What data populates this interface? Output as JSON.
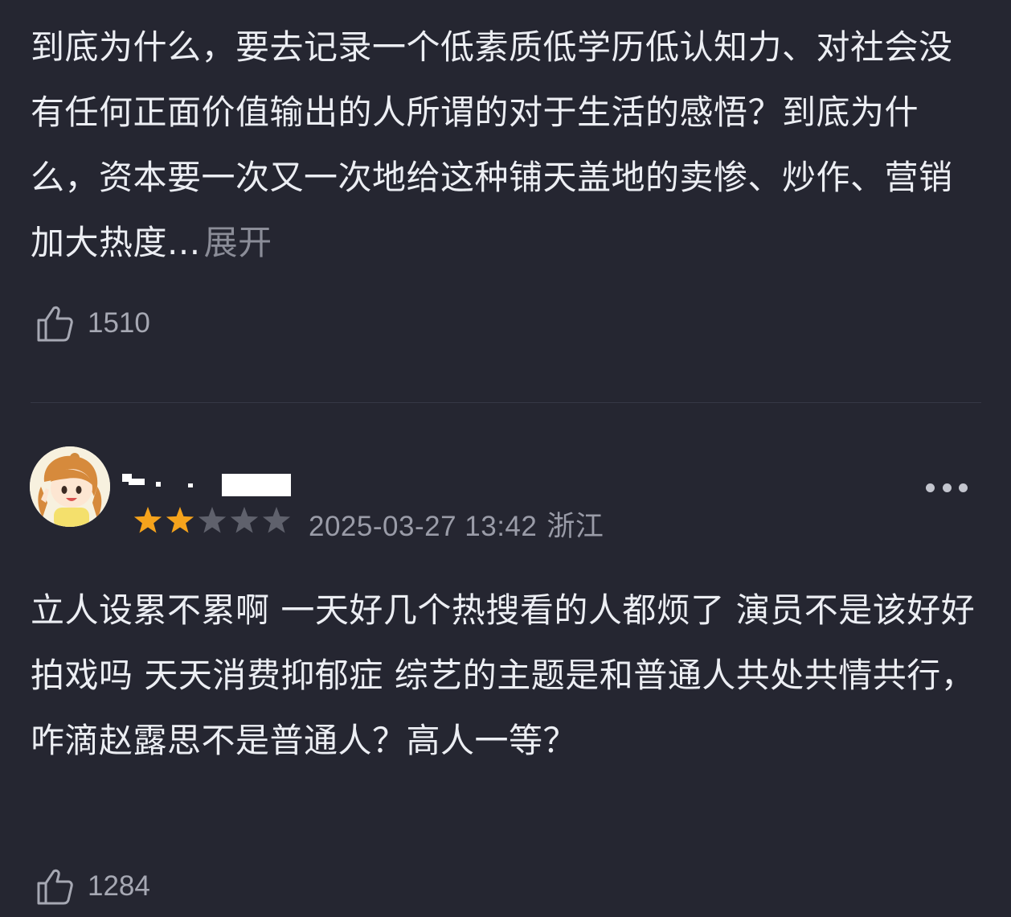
{
  "comments": [
    {
      "text": "到底为什么，要去记录一个低素质低学历低认知力、对社会没有任何正面价值输出的人所谓的对于生活的感悟？到底为什么，资本要一次又一次地给这种铺天盖地的卖惨、炒作、营销加大热度...",
      "expand_label": "展开",
      "likes": "1510"
    },
    {
      "avatar_icon": "cartoon-girl-avatar",
      "rating": 2,
      "rating_max": 5,
      "date": "2025-03-27 13:42",
      "location": "浙江",
      "more_icon": "more-dots-icon",
      "text": "立人设累不累啊 一天好几个热搜看的人都烦了 演员不是该好好拍戏吗 天天消费抑郁症 综艺的主题是和普通人共处共情共行，咋滴赵露思不是普通人？高人一等？",
      "likes": "1284"
    }
  ],
  "colors": {
    "background": "#252631",
    "star_filled": "#f5a31c",
    "star_empty": "#5f616c",
    "muted_text": "#9a9ca8"
  }
}
